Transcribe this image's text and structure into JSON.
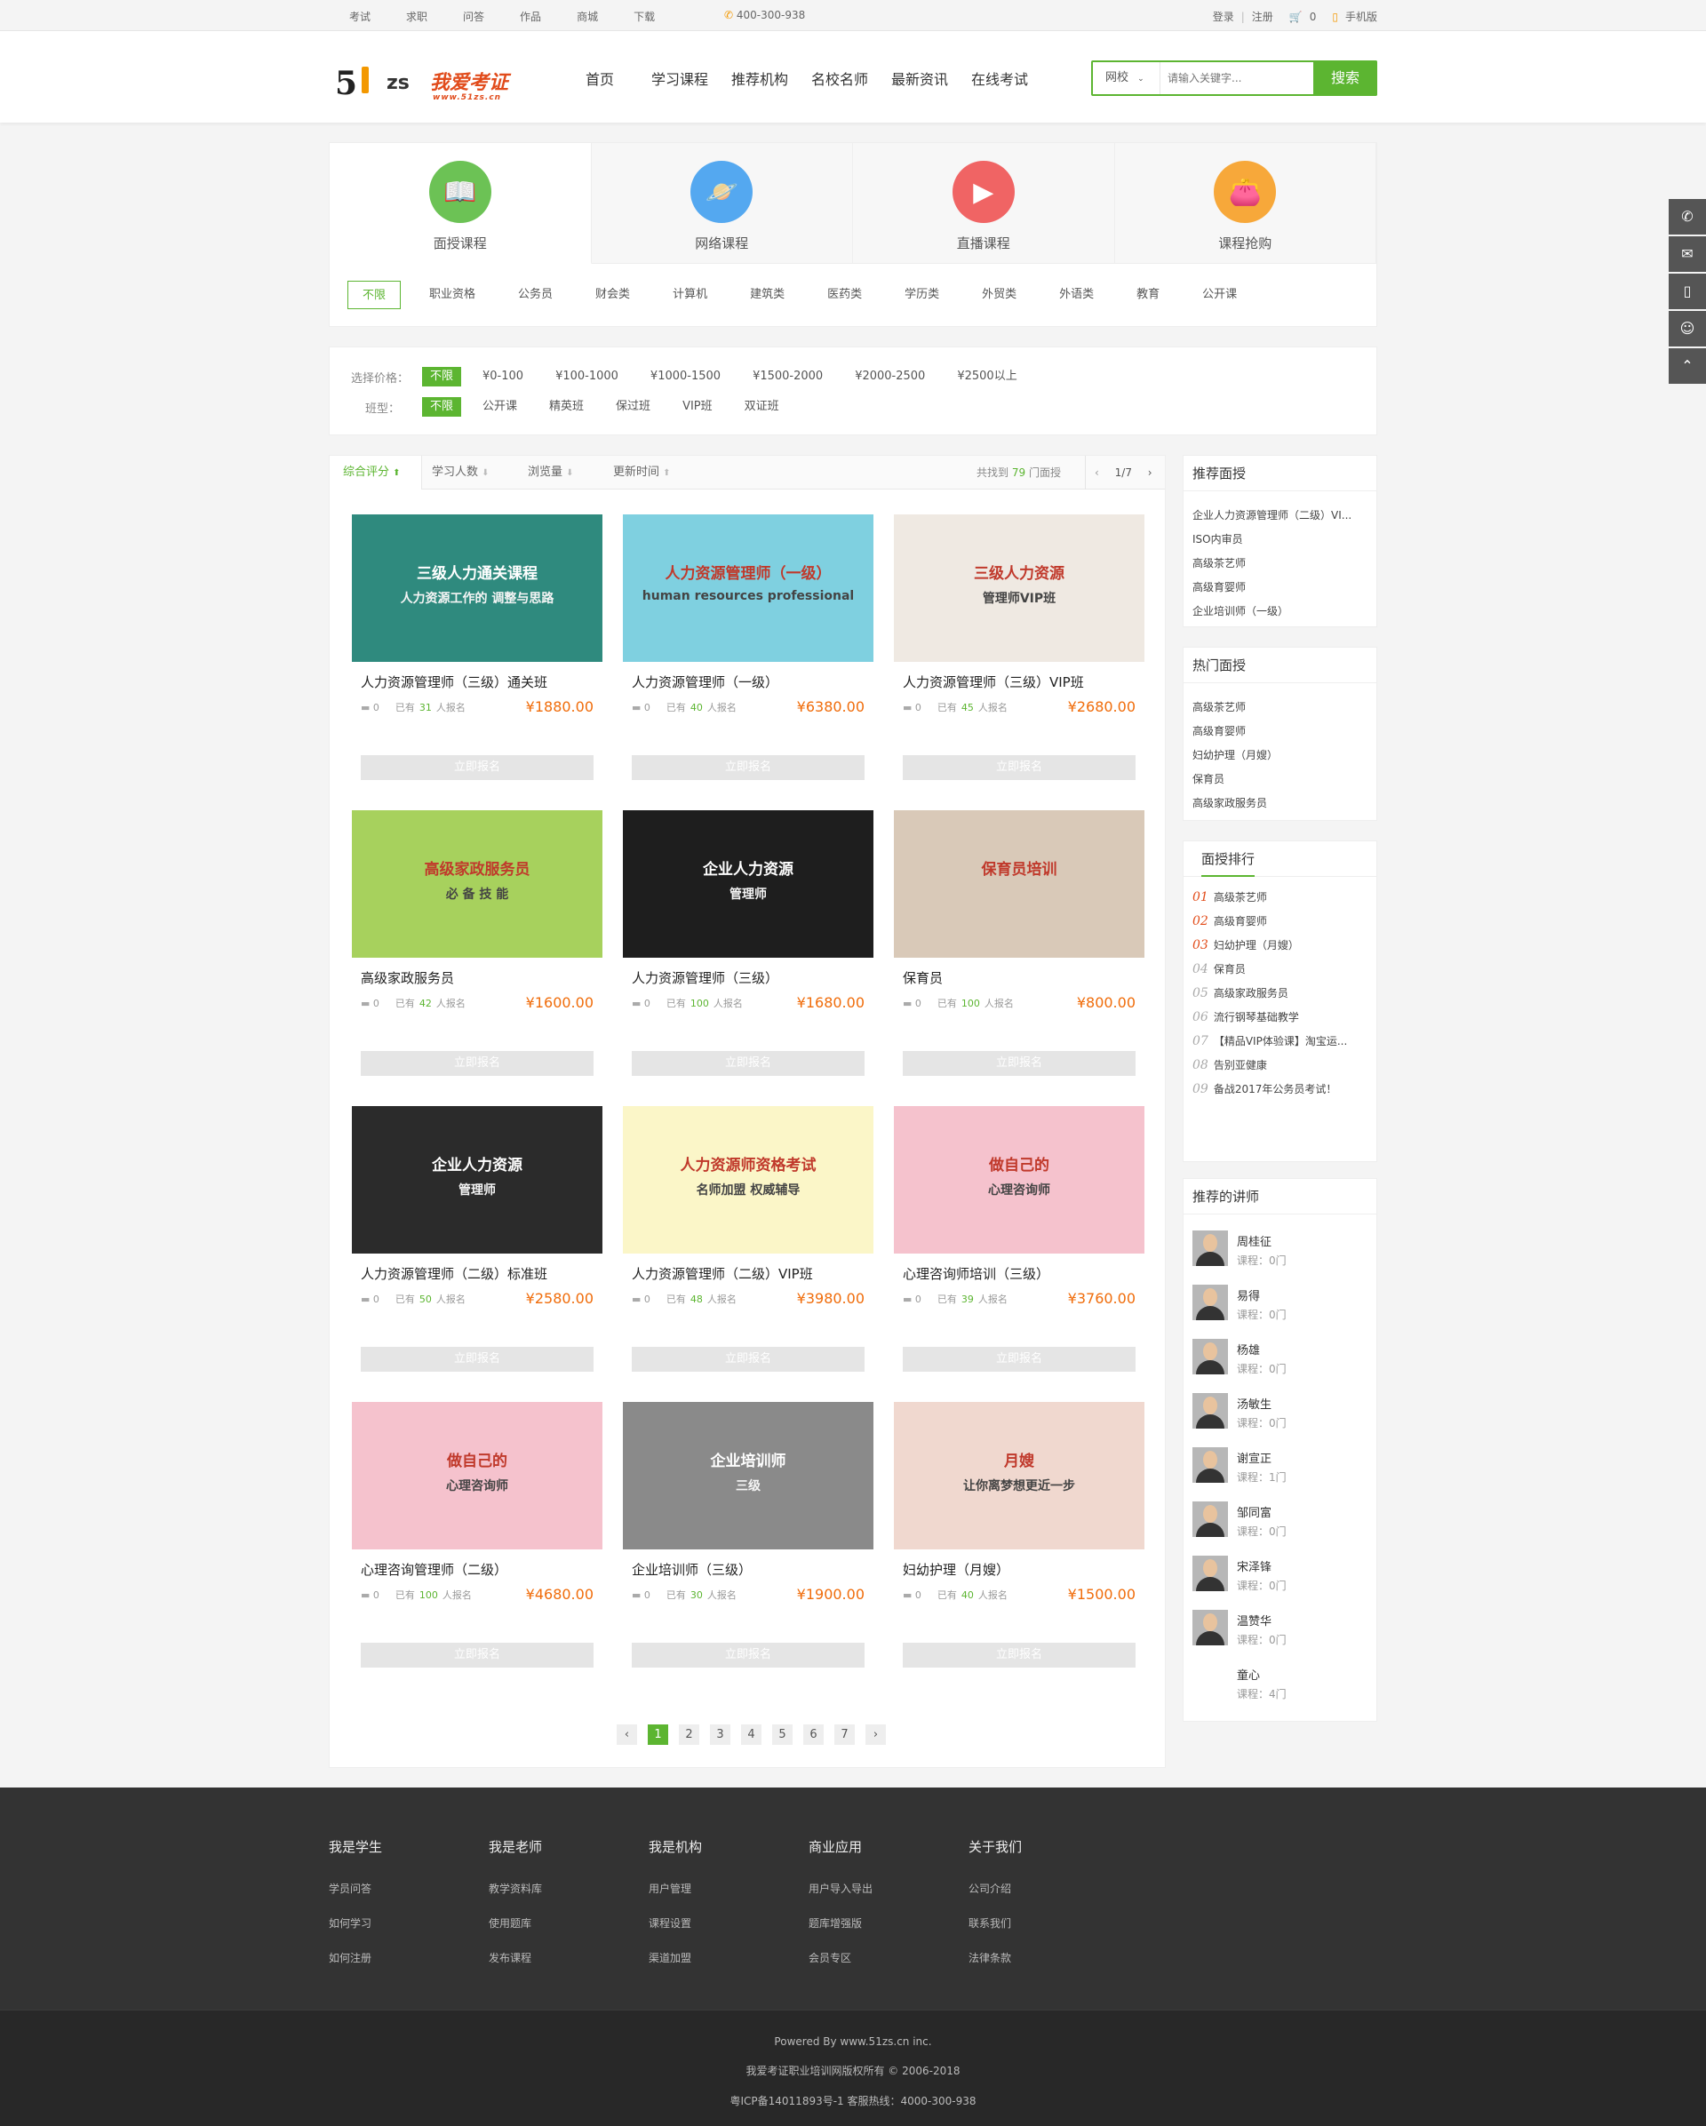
{
  "topbar": {
    "links": [
      "考试",
      "求职",
      "问答",
      "作品",
      "商城",
      "下载"
    ],
    "phone": "400-300-938",
    "login": "登录",
    "sep": "|",
    "register": "注册",
    "cart_count": "0",
    "mobile": "手机版"
  },
  "logo": {
    "mark1": "5",
    "mark2": "zs",
    "brand": "我爱考证",
    "url": "www.51zs.cn"
  },
  "nav": [
    "首页",
    "学习课程",
    "推荐机构",
    "名校名师",
    "最新资讯",
    "在线考试"
  ],
  "search": {
    "select": "网校",
    "placeholder": "请输入关键字...",
    "button": "搜索"
  },
  "category_tabs": [
    {
      "label": "面授课程",
      "color": "#6cc255",
      "icon": "book-icon"
    },
    {
      "label": "网络课程",
      "color": "#54a8f0",
      "icon": "planet-icon"
    },
    {
      "label": "直播课程",
      "color": "#f06464",
      "icon": "video-icon"
    },
    {
      "label": "课程抢购",
      "color": "#f7a83a",
      "icon": "wallet-icon"
    }
  ],
  "subcats": [
    "不限",
    "职业资格",
    "公务员",
    "财会类",
    "计算机",
    "建筑类",
    "医药类",
    "学历类",
    "外贸类",
    "外语类",
    "教育",
    "公开课"
  ],
  "filters": {
    "price_label": "选择价格：",
    "prices": [
      "不限",
      "¥0-100",
      "¥100-1000",
      "¥1000-1500",
      "¥1500-2000",
      "¥2000-2500",
      "¥2500以上"
    ],
    "class_label": "班型：",
    "classes": [
      "不限",
      "公开课",
      "精英班",
      "保过班",
      "VIP班",
      "双证班"
    ]
  },
  "sortbar": {
    "items": [
      "综合评分",
      "学习人数",
      "浏览量",
      "更新时间"
    ],
    "found_prefix": "共找到",
    "found_count": "79",
    "found_suffix": "门面授",
    "page": "1/7"
  },
  "courses": [
    {
      "title": "人力资源管理师（三级）通关班",
      "comments": "0",
      "enrolled": "31",
      "price": "¥1880.00",
      "img_text": "三级人力通关课程",
      "img_sub": "人力资源工作的 调整与思路",
      "bg": "#2f8a7e"
    },
    {
      "title": "人力资源管理师（一级）",
      "comments": "0",
      "enrolled": "40",
      "price": "¥6380.00",
      "img_text": "人力资源管理师（一级）",
      "img_sub": "human resources professional",
      "bg": "#7fd0e0"
    },
    {
      "title": "人力资源管理师（三级）VIP班",
      "comments": "0",
      "enrolled": "45",
      "price": "¥2680.00",
      "img_text": "三级人力资源",
      "img_sub": "管理师VIP班",
      "bg": "#efe9e2"
    },
    {
      "title": "高级家政服务员",
      "comments": "0",
      "enrolled": "42",
      "price": "¥1600.00",
      "img_text": "高级家政服务员",
      "img_sub": "必 备 技 能",
      "bg": "#a7d15d"
    },
    {
      "title": "人力资源管理师（三级）",
      "comments": "0",
      "enrolled": "100",
      "price": "¥1680.00",
      "img_text": "企业人力资源",
      "img_sub": "管理师",
      "bg": "#1e1e1e"
    },
    {
      "title": "保育员",
      "comments": "0",
      "enrolled": "100",
      "price": "¥800.00",
      "img_text": "保育员培训",
      "img_sub": "",
      "bg": "#d9c9b8"
    },
    {
      "title": "人力资源管理师（二级）标准班",
      "comments": "0",
      "enrolled": "50",
      "price": "¥2580.00",
      "img_text": "企业人力资源",
      "img_sub": "管理师",
      "bg": "#2b2b2b"
    },
    {
      "title": "人力资源管理师（二级）VIP班",
      "comments": "0",
      "enrolled": "48",
      "price": "¥3980.00",
      "img_text": "人力资源师资格考试",
      "img_sub": "名师加盟 权威辅导",
      "bg": "#fbf6c8"
    },
    {
      "title": "心理咨询师培训（三级）",
      "comments": "0",
      "enrolled": "39",
      "price": "¥3760.00",
      "img_text": "做自己的",
      "img_sub": "心理咨询师",
      "bg": "#f5c2cd"
    },
    {
      "title": "心理咨询管理师（二级）",
      "comments": "0",
      "enrolled": "100",
      "price": "¥4680.00",
      "img_text": "做自己的",
      "img_sub": "心理咨询师",
      "bg": "#f5c2cd"
    },
    {
      "title": "企业培训师（三级）",
      "comments": "0",
      "enrolled": "30",
      "price": "¥1900.00",
      "img_text": "企业培训师",
      "img_sub": "三级",
      "bg": "#8a8a8a"
    },
    {
      "title": "妇幼护理（月嫂）",
      "comments": "0",
      "enrolled": "40",
      "price": "¥1500.00",
      "img_text": "月嫂",
      "img_sub": "让你离梦想更近一步",
      "bg": "#f0d8cf"
    }
  ],
  "course_labels": {
    "enrolled_prefix": "已有",
    "enrolled_suffix": "人报名",
    "button": "立即报名"
  },
  "pager": {
    "prev": "‹",
    "pages": [
      "1",
      "2",
      "3",
      "4",
      "5",
      "6",
      "7"
    ],
    "next": "›"
  },
  "side_recommend": {
    "title": "推荐面授",
    "items": [
      "企业人力资源管理师（二级）VI...",
      "ISO内审员",
      "高级茶艺师",
      "高级育婴师",
      "企业培训师（一级）"
    ]
  },
  "side_hot": {
    "title": "热门面授",
    "items": [
      "高级茶艺师",
      "高级育婴师",
      "妇幼护理（月嫂）",
      "保育员",
      "高级家政服务员"
    ]
  },
  "side_rank": {
    "title": "面授排行",
    "items": [
      {
        "n": "01",
        "t": "高级茶艺师"
      },
      {
        "n": "02",
        "t": "高级育婴师"
      },
      {
        "n": "03",
        "t": "妇幼护理（月嫂）"
      },
      {
        "n": "04",
        "t": "保育员"
      },
      {
        "n": "05",
        "t": "高级家政服务员"
      },
      {
        "n": "06",
        "t": "流行钢琴基础教学"
      },
      {
        "n": "07",
        "t": "【精品VIP体验课】淘宝运..."
      },
      {
        "n": "08",
        "t": "告别亚健康"
      },
      {
        "n": "09",
        "t": "备战2017年公务员考试！"
      }
    ]
  },
  "side_teachers": {
    "title": "推荐的讲师",
    "items": [
      {
        "name": "周桂征",
        "courses": "课程：0门"
      },
      {
        "name": "易得",
        "courses": "课程：0门"
      },
      {
        "name": "杨雄",
        "courses": "课程：0门"
      },
      {
        "name": "汤敏生",
        "courses": "课程：0门"
      },
      {
        "name": "谢宣正",
        "courses": "课程：1门"
      },
      {
        "name": "邹同富",
        "courses": "课程：0门"
      },
      {
        "name": "宋泽锋",
        "courses": "课程：0门"
      },
      {
        "name": "温赞华",
        "courses": "课程：0门"
      },
      {
        "name": "童心",
        "courses": "课程：4门"
      }
    ]
  },
  "footer": {
    "cols": [
      {
        "title": "我是学生",
        "links": [
          "学员问答",
          "如何学习",
          "如何注册"
        ]
      },
      {
        "title": "我是老师",
        "links": [
          "教学资料库",
          "使用题库",
          "发布课程"
        ]
      },
      {
        "title": "我是机构",
        "links": [
          "用户管理",
          "课程设置",
          "渠道加盟"
        ]
      },
      {
        "title": "商业应用",
        "links": [
          "用户导入导出",
          "题库增强版",
          "会员专区"
        ]
      },
      {
        "title": "关于我们",
        "links": [
          "公司介绍",
          "联系我们",
          "法律条款"
        ]
      }
    ],
    "powered": "Powered By www.51zs.cn inc.",
    "copyright": "我爱考证职业培训网版权所有 © 2006-2018",
    "icp": "粤ICP备14011893号-1 客服热线：4000-300-938"
  },
  "colors": {
    "accent": "#5cb531",
    "price": "#f06c0a",
    "rank_red": "#e24c1a"
  }
}
